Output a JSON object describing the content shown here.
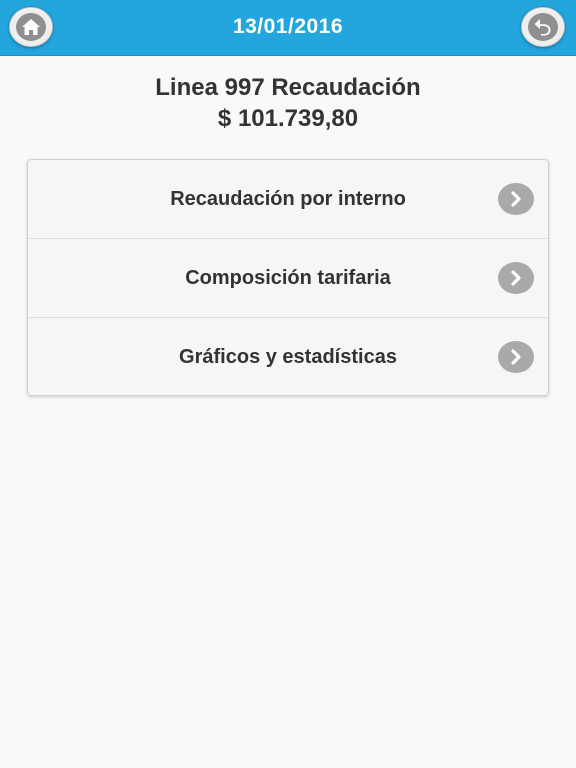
{
  "header": {
    "date": "13/01/2016",
    "home_icon": "home-icon",
    "back_icon": "undo-arrow-icon",
    "background_color": "#22a6dd"
  },
  "summary": {
    "line_title": "Linea 997 Recaudación",
    "amount": "$ 101.739,80"
  },
  "menu": {
    "items": [
      {
        "label": "Recaudación por interno",
        "icon": "chevron-right-icon"
      },
      {
        "label": "Composición tarifaria",
        "icon": "chevron-right-icon"
      },
      {
        "label": "Gráficos y estadísticas",
        "icon": "chevron-right-icon"
      }
    ]
  }
}
